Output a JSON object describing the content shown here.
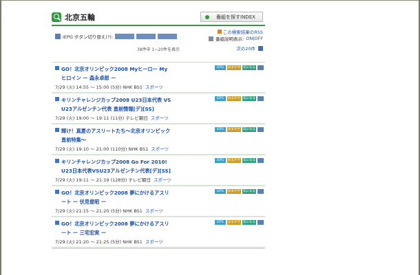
{
  "header": {
    "title": "北京五輪",
    "index_button": "番組を探すINDEX"
  },
  "controls": {
    "rss_link": "この検索結果のRSS",
    "iepg_label": "iEPG ボタン切り替え(?):",
    "iepg_switches": [
      "iEPG",
      "iEPGデジタル",
      "iEPGワンセグ"
    ],
    "desc_label": "番組説明表示:",
    "desc_on": "ON",
    "desc_sep": " | ",
    "desc_off": "OFF",
    "result_count": "38件中  1~20件を表示",
    "next_link": "次の20件"
  },
  "badges": [
    "iEPG",
    "おまかせ",
    "気になる"
  ],
  "programs": [
    {
      "title": "GO！北京オリンピック2008 Myヒーロー Myヒロイン ー 森永卓郎 ー",
      "time": "7/29 (火) 14:55 ～ 15:00 (5分)",
      "channel": "NHK BS1",
      "genre": "スポーツ"
    },
    {
      "title": "キリンチャレンジカップ2008 U23日本代表 VSU23アルゼンチン代表 直前情報[デ][SS]",
      "time": "7/29 (火) 19:00 ～ 19:11 (11分)",
      "channel": "テレビ朝日",
      "genre": "スポーツ"
    },
    {
      "title": "輝け！真夏のアスリートたち～北京オリンピック直前特集～",
      "time": "7/29 (火) 19:10 ～ 21:00 (110分)",
      "channel": "NHK BS1",
      "genre": "スポーツ"
    },
    {
      "title": "キリンチャレンジカップ2008 Go For 2010! U23日本代表VSU23アルゼンチン代表[デ][SS]",
      "time": "7/29 (火) 19:11 ～ 21:19 (128分)",
      "channel": "テレビ朝日",
      "genre": "スポーツ"
    },
    {
      "title": "GO！北京オリンピック2008 夢にかけるアスリート ー 伏見俊昭 ー",
      "time": "7/29 (火) 21:15 ～ 21:20 (5分)",
      "channel": "NHK BS1",
      "genre": "スポーツ"
    },
    {
      "title": "GO！北京オリンピック2008 夢にかけるアスリート ー 三宅宏実 ー",
      "time": "7/29 (火) 21:20 ～ 21:25 (5分)",
      "channel": "NHK BS1",
      "genre": "スポーツ"
    }
  ],
  "colors": {
    "accent": "#2a9a3a",
    "link": "#1a52b0"
  }
}
